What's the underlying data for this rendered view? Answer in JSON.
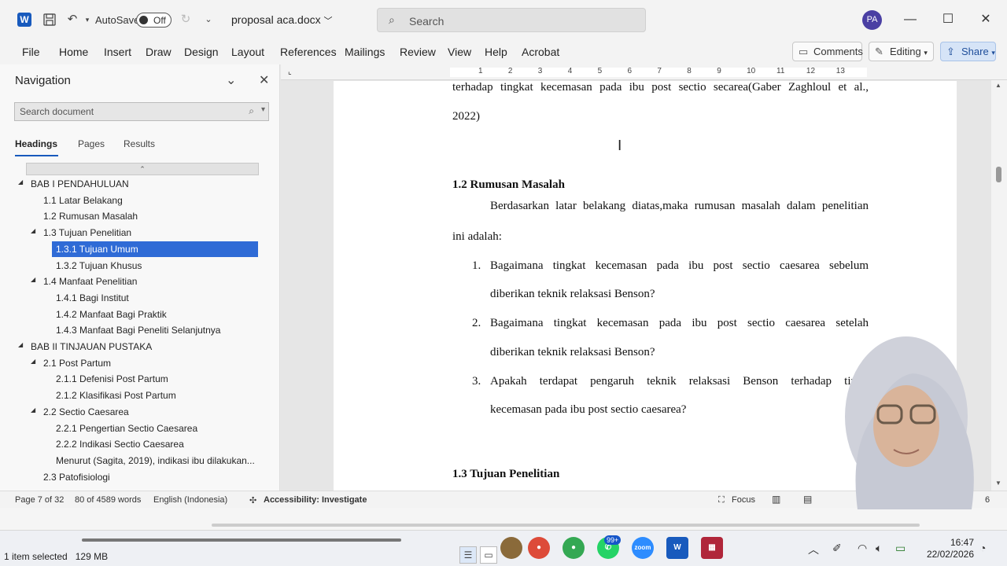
{
  "titlebar": {
    "autosave_label": "AutoSave",
    "autosave_state": "Off",
    "document_name": "proposal aca.docx",
    "search_placeholder": "Search",
    "user_initials": "PA"
  },
  "ribbon": {
    "tabs": [
      "File",
      "Home",
      "Insert",
      "Draw",
      "Design",
      "Layout",
      "References",
      "Mailings",
      "Review",
      "View",
      "Help",
      "Acrobat"
    ],
    "comments_label": "Comments",
    "editing_label": "Editing",
    "share_label": "Share"
  },
  "navigation": {
    "title": "Navigation",
    "search_placeholder": "Search document",
    "tabs": [
      "Headings",
      "Pages",
      "Results"
    ],
    "collapse_glyph": "⌃",
    "headings": [
      {
        "label": "BAB I  PENDAHULUAN",
        "level": 1,
        "expandable": true,
        "selected": false
      },
      {
        "label": "1.1 Latar Belakang",
        "level": 2,
        "expandable": false,
        "selected": false
      },
      {
        "label": "1.2 Rumusan Masalah",
        "level": 2,
        "expandable": false,
        "selected": false
      },
      {
        "label": "1.3 Tujuan Penelitian",
        "level": 2,
        "expandable": true,
        "selected": false
      },
      {
        "label": "1.3.1 Tujuan Umum",
        "level": 3,
        "expandable": false,
        "selected": true
      },
      {
        "label": "1.3.2 Tujuan Khusus",
        "level": 3,
        "expandable": false,
        "selected": false
      },
      {
        "label": "1.4 Manfaat Penelitian",
        "level": 2,
        "expandable": true,
        "selected": false
      },
      {
        "label": "1.4.1 Bagi Institut",
        "level": 3,
        "expandable": false,
        "selected": false
      },
      {
        "label": "1.4.2 Manfaat Bagi Praktik",
        "level": 3,
        "expandable": false,
        "selected": false
      },
      {
        "label": "1.4.3 Manfaat Bagi Peneliti Selanjutnya",
        "level": 3,
        "expandable": false,
        "selected": false
      },
      {
        "label": "BAB II   TINJAUAN PUSTAKA",
        "level": 1,
        "expandable": true,
        "selected": false
      },
      {
        "label": "2.1 Post Partum",
        "level": 2,
        "expandable": true,
        "selected": false
      },
      {
        "label": "2.1.1 Defenisi Post Partum",
        "level": 3,
        "expandable": false,
        "selected": false
      },
      {
        "label": "2.1.2 Klasifikasi Post Partum",
        "level": 3,
        "expandable": false,
        "selected": false
      },
      {
        "label": "2.2 Sectio Caesarea",
        "level": 2,
        "expandable": true,
        "selected": false
      },
      {
        "label": "2.2.1 Pengertian Sectio Caesarea",
        "level": 3,
        "expandable": false,
        "selected": false
      },
      {
        "label": "2.2.2 Indikasi Sectio Caesarea",
        "level": 3,
        "expandable": false,
        "selected": false
      },
      {
        "label": "Menurut (Sagita, 2019), indikasi ibu dilakukan...",
        "level": 3,
        "expandable": false,
        "selected": false
      },
      {
        "label": "2.3 Patofisiologi",
        "level": 2,
        "expandable": false,
        "selected": false
      }
    ]
  },
  "ruler": {
    "numbers": [
      "1",
      "2",
      "3",
      "4",
      "5",
      "6",
      "7",
      "8",
      "9",
      "10",
      "11",
      "12",
      "13"
    ]
  },
  "document": {
    "line1": "terhadap tingkat kecemasan pada ibu post sectio secarea(Gaber Zaghloul et al.,",
    "line2": "2022)",
    "heading_12": "1.2 Rumusan Masalah",
    "para1_line1": "Berdasarkan latar belakang diatas,maka rumusan masalah dalam penelitian",
    "para1_line2": "ini adalah:",
    "items": [
      {
        "num": "1.",
        "line1": "Bagaimana tingkat kecemasan pada ibu post sectio caesarea sebelum",
        "line2": "diberikan teknik relaksasi Benson?"
      },
      {
        "num": "2.",
        "line1": "Bagaimana tingkat kecemasan pada ibu post sectio caesarea setelah",
        "line2": "diberikan teknik relaksasi Benson?"
      },
      {
        "num": "3.",
        "line1": "Apakah terdapat pengaruh teknik relaksasi Benson terhadap tingk",
        "line2": "kecemasan pada ibu post sectio caesarea?"
      }
    ],
    "heading_13": "1.3 Tujuan Penelitian"
  },
  "statusbar": {
    "page": "Page 7 of 32",
    "words": "80 of 4589 words",
    "language": "English (Indonesia)",
    "accessibility": "Accessibility: Investigate",
    "focus": "Focus",
    "zoom_partial": "6"
  },
  "taskbar": {
    "explorer_selected": "1 item selected",
    "explorer_size": "129 MB",
    "whatsapp_badge": "99+",
    "zoom_label": "zoom",
    "time": "16:47",
    "date": "22/02/2026"
  }
}
